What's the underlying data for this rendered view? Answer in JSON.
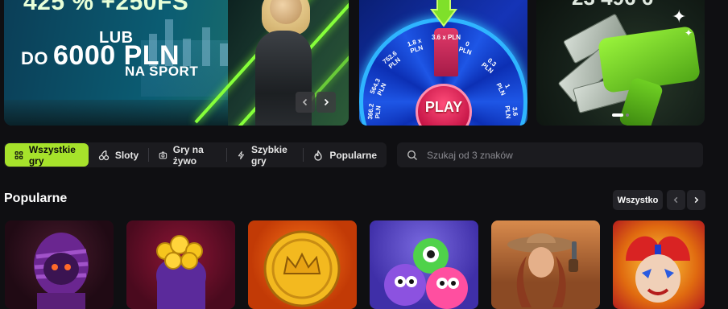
{
  "banners": [
    {
      "lines": {
        "top": "425 % +250FS",
        "lub": "LUB",
        "do_prefix": "DO",
        "amount": "6000 PLN",
        "sport": "NA SPORT"
      }
    },
    {
      "wheel_labels": [
        "3.6 x PLN",
        "1.8 x PLN",
        "0 PLN",
        "752.6 PLN",
        "0.3 PLN",
        "564.3 PLN",
        "1 PLN",
        "366.2 PLN",
        "3.6 PLN"
      ],
      "play_label": "PLAY"
    },
    {
      "top_text": "23 496 6"
    }
  ],
  "categories": [
    {
      "label": "Wszystkie gry",
      "icon": "grid-icon",
      "active": true
    },
    {
      "label": "Sloty",
      "icon": "cherries-icon",
      "active": false
    },
    {
      "label": "Gry na żywo",
      "icon": "live-camera-icon",
      "active": false
    },
    {
      "label": "Szybkie gry",
      "icon": "lightning-icon",
      "active": false
    },
    {
      "label": "Popularne",
      "icon": "flame-icon",
      "active": false
    }
  ],
  "search": {
    "placeholder": "Szukaj od 3 znaków",
    "value": ""
  },
  "section": {
    "title": "Popularne",
    "all_label": "Wszystko"
  },
  "games": [
    {
      "name": "mummy-game"
    },
    {
      "name": "coin-sack-game"
    },
    {
      "name": "gold-coin-game"
    },
    {
      "name": "monsters-game"
    },
    {
      "name": "cowgirl-game"
    },
    {
      "name": "jester-game"
    }
  ],
  "colors": {
    "accent": "#a6e22b",
    "background": "#0f0f12",
    "surface": "#1b1b1f"
  }
}
